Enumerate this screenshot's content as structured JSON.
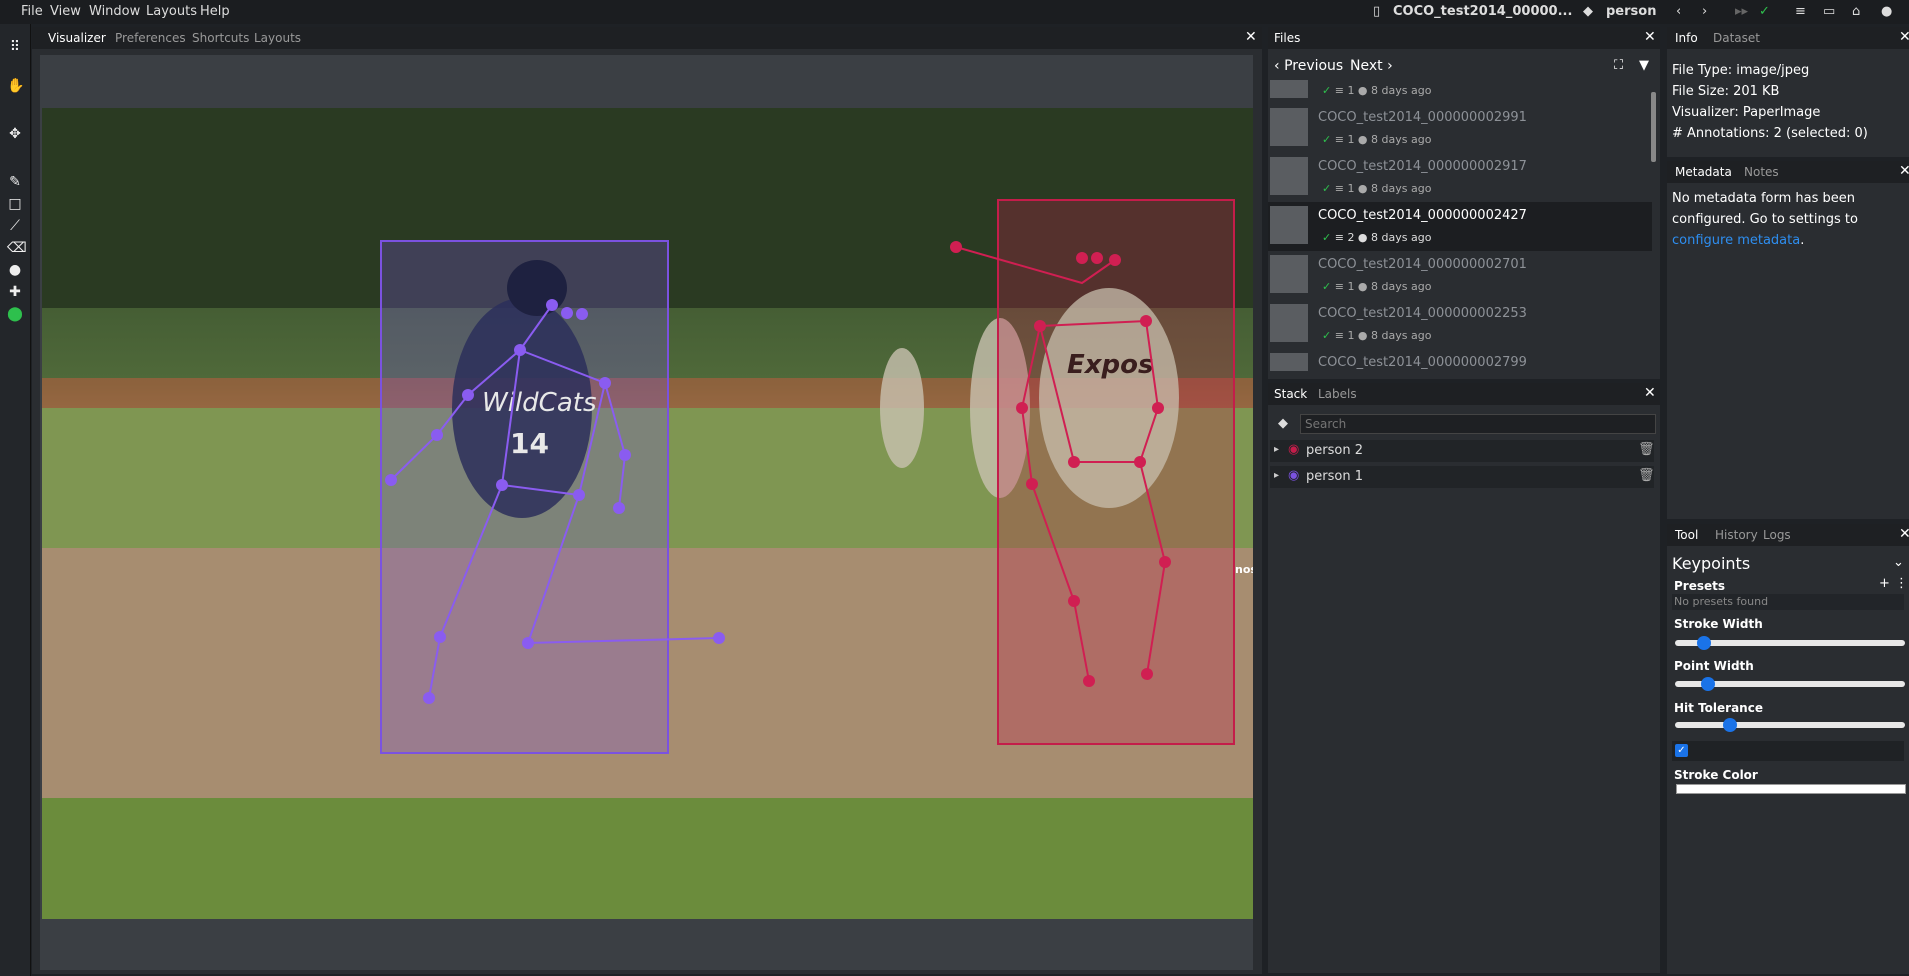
{
  "menu": [
    "File",
    "View",
    "Window",
    "Layouts",
    "Help"
  ],
  "header": {
    "filename": "COCO_test2014_00000...",
    "label": "person"
  },
  "viz_tabs": [
    "Visualizer",
    "Preferences",
    "Shortcuts",
    "Layouts"
  ],
  "files": {
    "tab": "Files",
    "prev_label": "Previous",
    "next_label": "Next",
    "items": [
      {
        "name": "",
        "count": "1",
        "time": "8 days ago",
        "active": false
      },
      {
        "name": "COCO_test2014_000000002991",
        "count": "1",
        "time": "8 days ago",
        "active": false
      },
      {
        "name": "COCO_test2014_000000002917",
        "count": "1",
        "time": "8 days ago",
        "active": false
      },
      {
        "name": "COCO_test2014_000000002427",
        "count": "2",
        "time": "8 days ago",
        "active": true
      },
      {
        "name": "COCO_test2014_000000002701",
        "count": "1",
        "time": "8 days ago",
        "active": false
      },
      {
        "name": "COCO_test2014_000000002253",
        "count": "1",
        "time": "8 days ago",
        "active": false
      },
      {
        "name": "COCO_test2014_000000002799",
        "count": "",
        "time": "",
        "active": false
      }
    ]
  },
  "stack": {
    "tabs": [
      "Stack",
      "Labels"
    ],
    "search_placeholder": "Search",
    "items": [
      "person 2",
      "person 1"
    ]
  },
  "info": {
    "tabs": [
      "Info",
      "Dataset"
    ],
    "file_type": "File Type: image/jpeg",
    "file_size": "File Size: 201 KB",
    "visualizer": "Visualizer: PaperImage",
    "annotations": "# Annotations: 2 (selected: 0)"
  },
  "metadata": {
    "tabs": [
      "Metadata",
      "Notes"
    ],
    "text": "No metadata form has been configured. Go to settings to",
    "link": "configure metadata",
    "suffix": "."
  },
  "tool": {
    "tabs": [
      "Tool",
      "History",
      "Logs"
    ],
    "title": "Keypoints",
    "presets_label": "Presets",
    "no_presets": "No presets found",
    "stroke_width": "Stroke Width",
    "point_width": "Point Width",
    "hit_tolerance": "Hit Tolerance",
    "stroke_color": "Stroke Color",
    "stroke_width_level": 0.1,
    "point_width_level": 0.12,
    "hit_tolerance_level": 0.22
  },
  "photo": {
    "jersey_left_text": "WildCats",
    "jersey_left_number": "14",
    "jersey_right_text": "Expos",
    "edge_label": "nos"
  },
  "colors": {
    "person1": "#7b52e0",
    "person2": "#c41d4a",
    "accent": "#1a73e8",
    "check": "#2ec04d"
  }
}
